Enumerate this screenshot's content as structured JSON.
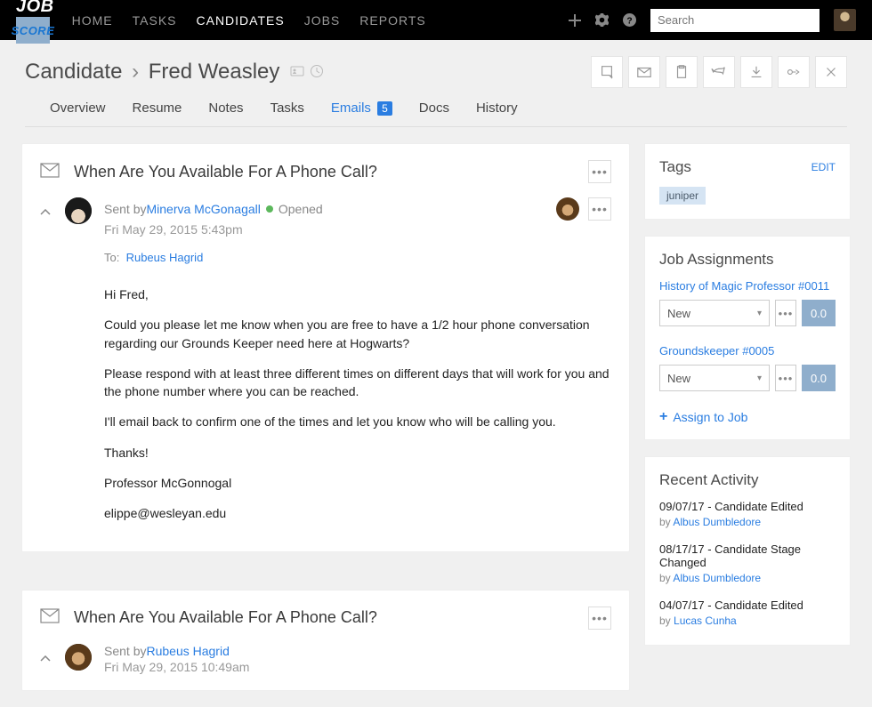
{
  "nav": {
    "logo_job": "JOB",
    "logo_score": "SCORE",
    "links": [
      "HOME",
      "TASKS",
      "CANDIDATES",
      "JOBS",
      "REPORTS"
    ],
    "active_index": 2,
    "search_placeholder": "Search"
  },
  "header": {
    "breadcrumb_root": "Candidate",
    "candidate_name": "Fred Weasley"
  },
  "tabs": {
    "items": [
      "Overview",
      "Resume",
      "Notes",
      "Tasks",
      "Emails",
      "Docs",
      "History"
    ],
    "active_index": 4,
    "emails_badge": "5"
  },
  "emails": [
    {
      "subject": "When Are You Available For A Phone Call?",
      "sent_by_prefix": "Sent by ",
      "sender": "Minerva McGonagall",
      "status": "Opened",
      "date": "Fri May 29, 2015 5:43pm",
      "to_label": "To:",
      "to_name": "Rubeus Hagrid",
      "body": [
        "Hi Fred,",
        "Could you please let me know when you are free to have a 1/2 hour phone conversation regarding our Grounds Keeper need here at Hogwarts?",
        "Please respond with at least three different times on different days that will work for you and the phone number where you can be reached.",
        "I'll email back to confirm one of the times and let you know who will be calling you.",
        "Thanks!",
        "Professor McGonnogal",
        "elippe@wesleyan.edu"
      ]
    },
    {
      "subject": "When Are You Available For A Phone Call?",
      "sent_by_prefix": "Sent by ",
      "sender": "Rubeus Hagrid",
      "date": "Fri May 29, 2015 10:49am"
    }
  ],
  "sidebar": {
    "tags": {
      "title": "Tags",
      "edit": "EDIT",
      "items": [
        "juniper"
      ]
    },
    "jobs": {
      "title": "Job Assignments",
      "items": [
        {
          "name": "History of Magic Professor #0011",
          "stage": "New",
          "score": "0.0"
        },
        {
          "name": "Groundskeeper #0005",
          "stage": "New",
          "score": "0.0"
        }
      ],
      "assign_label": "Assign to Job"
    },
    "activity": {
      "title": "Recent Activity",
      "items": [
        {
          "title": "09/07/17 - Candidate Edited",
          "by_prefix": "by ",
          "by": "Albus Dumbledore"
        },
        {
          "title": "08/17/17 - Candidate Stage Changed",
          "by_prefix": "by ",
          "by": "Albus Dumbledore"
        },
        {
          "title": "04/07/17 - Candidate Edited",
          "by_prefix": "by ",
          "by": "Lucas Cunha"
        }
      ]
    }
  }
}
